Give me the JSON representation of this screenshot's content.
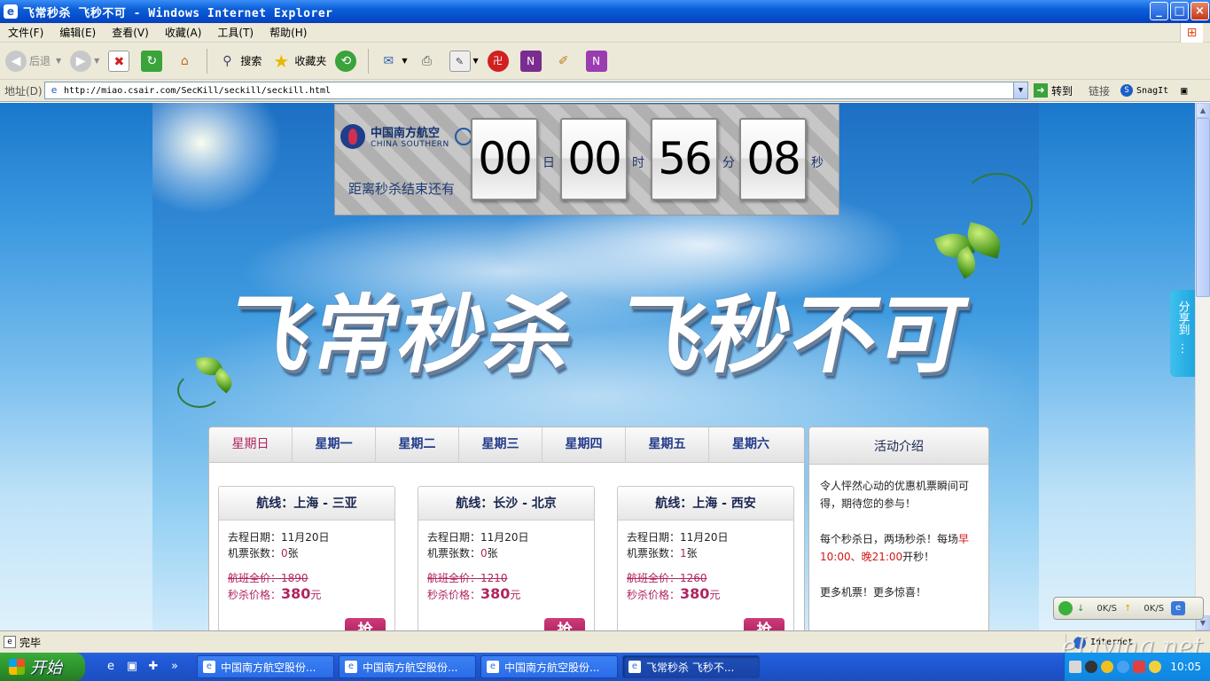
{
  "window": {
    "title": "飞常秒杀 飞秒不可 - Windows Internet Explorer",
    "minimize": "_",
    "maximize": "□",
    "close": "×"
  },
  "menu": [
    "文件(F)",
    "编辑(E)",
    "查看(V)",
    "收藏(A)",
    "工具(T)",
    "帮助(H)"
  ],
  "toolbar": {
    "back": "后退",
    "search": "搜索",
    "favorites": "收藏夹"
  },
  "address": {
    "label": "地址(D)",
    "url": "http://miao.csair.com/SecKill/seckill/seckill.html",
    "go": "转到",
    "links": "链接",
    "snagit": "SnagIt"
  },
  "countdown": {
    "brand_cn": "中国南方航空",
    "brand_en": "CHINA SOUTHERN",
    "label": "距离秒杀结束还有",
    "days": "00",
    "days_unit": "日",
    "hours": "00",
    "hours_unit": "时",
    "minutes": "56",
    "minutes_unit": "分",
    "seconds": "08",
    "seconds_unit": "秒"
  },
  "slogan": {
    "left": "飞常秒杀",
    "right": "飞秒不可"
  },
  "share": "分享到",
  "tabs": [
    "星期日",
    "星期一",
    "星期二",
    "星期三",
    "星期四",
    "星期五",
    "星期六"
  ],
  "active_tab": 0,
  "cards": [
    {
      "route": "航线：上海 - 三亚",
      "date": "去程日期：11月20日",
      "tickets_label": "机票张数：",
      "tickets": "0",
      "tickets_unit": "张",
      "full_label": "航班全价：",
      "full_price": "1890",
      "sale_label": "秒杀价格：",
      "sale_price": "380",
      "sale_unit": "元",
      "button": "抢"
    },
    {
      "route": "航线：长沙 - 北京",
      "date": "去程日期：11月20日",
      "tickets_label": "机票张数：",
      "tickets": "0",
      "tickets_unit": "张",
      "full_label": "航班全价：",
      "full_price": "1210",
      "sale_label": "秒杀价格：",
      "sale_price": "380",
      "sale_unit": "元",
      "button": "抢"
    },
    {
      "route": "航线：上海 - 西安",
      "date": "去程日期：11月20日",
      "tickets_label": "机票张数：",
      "tickets": "1",
      "tickets_unit": "张",
      "full_label": "航班全价：",
      "full_price": "1260",
      "sale_label": "秒杀价格：",
      "sale_price": "380",
      "sale_unit": "元",
      "button": "抢"
    }
  ],
  "intro": {
    "title": "活动介绍",
    "p1": "令人怦然心动的优惠机票瞬间可得，期待您的参与！",
    "p2_a": "每个秒杀日，两场秒杀！每场",
    "p2_b": "早10:00、晚21:00",
    "p2_c": "开秒！",
    "p3": "更多机票！更多惊喜！"
  },
  "netspeed": {
    "down": "0K/S",
    "up": "0K/S"
  },
  "status": {
    "text": "完毕",
    "zone": "Internet"
  },
  "watermark": "eLiving.net",
  "taskbar": {
    "start": "开始",
    "tasks": [
      "中国南方航空股份...",
      "中国南方航空股份...",
      "中国南方航空股份...",
      "飞常秒杀 飞秒不..."
    ],
    "clock": "10:05"
  }
}
